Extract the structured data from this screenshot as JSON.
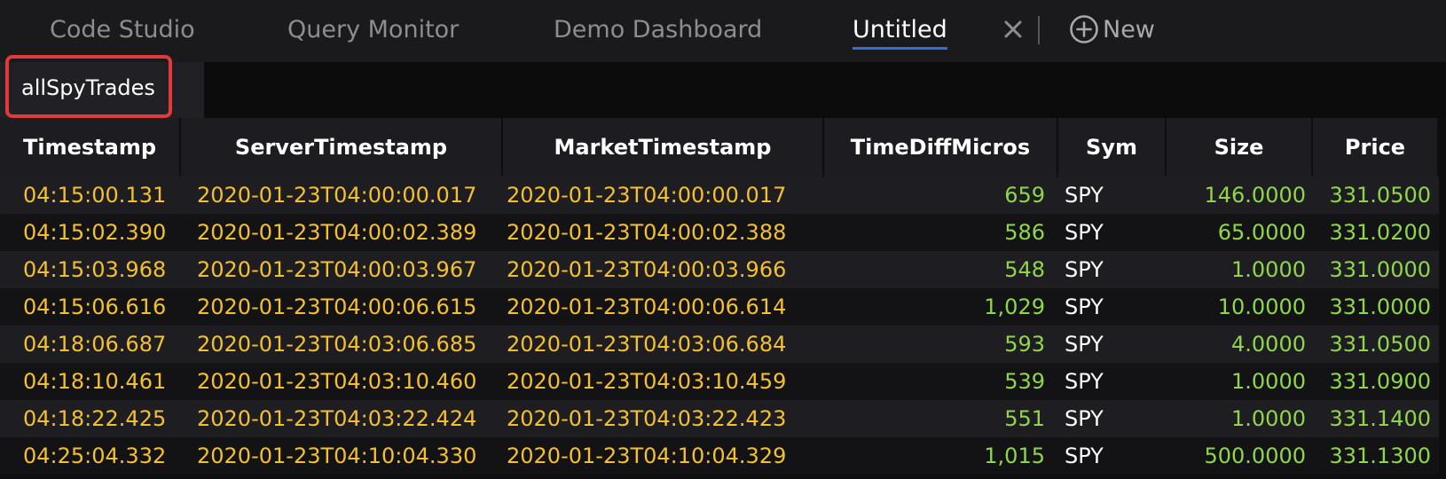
{
  "tabs": [
    {
      "label": "Code Studio"
    },
    {
      "label": "Query Monitor"
    },
    {
      "label": "Demo Dashboard"
    },
    {
      "label": "Untitled",
      "active": true
    }
  ],
  "new_label": "New",
  "close_icon": "close-icon",
  "new_icon": "plus-circle-icon",
  "subtab": {
    "label": "allSpyTrades"
  },
  "columns": [
    "Timestamp",
    "ServerTimestamp",
    "MarketTimestamp",
    "TimeDiffMicros",
    "Sym",
    "Size",
    "Price"
  ],
  "rows": [
    [
      "04:15:00.131",
      "2020-01-23T04:00:00.017",
      "2020-01-23T04:00:00.017",
      "659",
      "SPY",
      "146.0000",
      "331.0500"
    ],
    [
      "04:15:02.390",
      "2020-01-23T04:00:02.389",
      "2020-01-23T04:00:02.388",
      "586",
      "SPY",
      "65.0000",
      "331.0200"
    ],
    [
      "04:15:03.968",
      "2020-01-23T04:00:03.967",
      "2020-01-23T04:00:03.966",
      "548",
      "SPY",
      "1.0000",
      "331.0000"
    ],
    [
      "04:15:06.616",
      "2020-01-23T04:00:06.615",
      "2020-01-23T04:00:06.614",
      "1,029",
      "SPY",
      "10.0000",
      "331.0000"
    ],
    [
      "04:18:06.687",
      "2020-01-23T04:03:06.685",
      "2020-01-23T04:03:06.684",
      "593",
      "SPY",
      "4.0000",
      "331.0500"
    ],
    [
      "04:18:10.461",
      "2020-01-23T04:03:10.460",
      "2020-01-23T04:03:10.459",
      "539",
      "SPY",
      "1.0000",
      "331.0900"
    ],
    [
      "04:18:22.425",
      "2020-01-23T04:03:22.424",
      "2020-01-23T04:03:22.423",
      "551",
      "SPY",
      "1.0000",
      "331.1400"
    ],
    [
      "04:25:04.332",
      "2020-01-23T04:10:04.330",
      "2020-01-23T04:10:04.329",
      "1,015",
      "SPY",
      "500.0000",
      "331.1300"
    ]
  ],
  "colors": {
    "timestamp": "#f4c02e",
    "number": "#8fd64a",
    "text": "#ffffff",
    "highlight": "#e03a3a",
    "active_underline": "#2f6fe0"
  }
}
